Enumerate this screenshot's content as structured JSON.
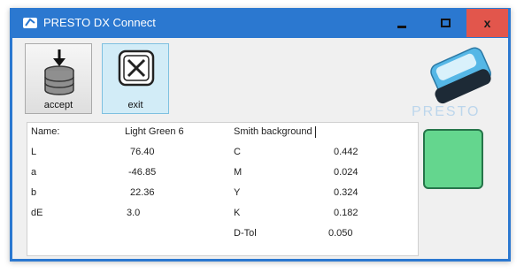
{
  "window": {
    "title": "PRESTO DX Connect"
  },
  "titlebar": {
    "close_glyph": "x"
  },
  "toolbar": {
    "accept_label": "accept",
    "accept_icon": "database-download-icon",
    "exit_label": "exit",
    "exit_icon": "close-box-icon"
  },
  "logo": {
    "text": "PRESTO"
  },
  "measurement": {
    "name_label": "Name:",
    "name_value": "Light Green 6",
    "sample_value": "Smith background",
    "lab": [
      {
        "label": "L",
        "value": "76.40"
      },
      {
        "label": "a",
        "value": "-46.85"
      },
      {
        "label": "b",
        "value": "22.36"
      },
      {
        "label": "dE",
        "value": "3.0"
      }
    ],
    "cmyk": [
      {
        "label": "C",
        "value": "0.442"
      },
      {
        "label": "M",
        "value": "0.024"
      },
      {
        "label": "Y",
        "value": "0.324"
      },
      {
        "label": "K",
        "value": "0.182"
      },
      {
        "label": "D-Tol",
        "value": "0.050"
      }
    ]
  },
  "swatch": {
    "color": "#64d68e"
  }
}
